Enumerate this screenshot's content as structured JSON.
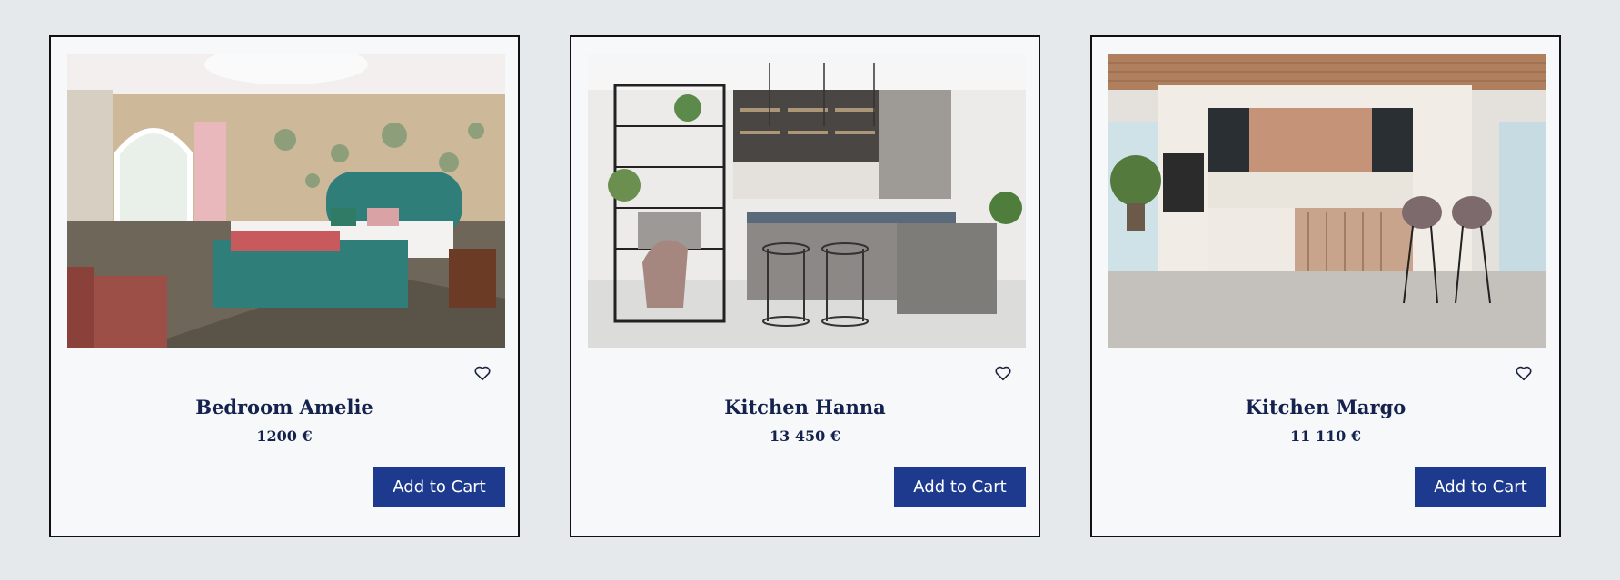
{
  "products": [
    {
      "name": "Bedroom Amelie",
      "price": "1200 €",
      "cart_label": "Add to Cart",
      "image": "bedroom-photo"
    },
    {
      "name": "Kitchen Hanna",
      "price": "13 450 €",
      "cart_label": "Add to Cart",
      "image": "kitchen-photo"
    },
    {
      "name": "Kitchen Margo",
      "price": "11 110 €",
      "cart_label": "Add to Cart",
      "image": "kitchen-photo"
    }
  ],
  "colors": {
    "page_bg": "#e6e9ec",
    "card_bg": "#f6f8fa",
    "title": "#14224d",
    "button_bg": "#1d3a8f"
  },
  "icons": {
    "favorite": "heart-outline-icon"
  }
}
